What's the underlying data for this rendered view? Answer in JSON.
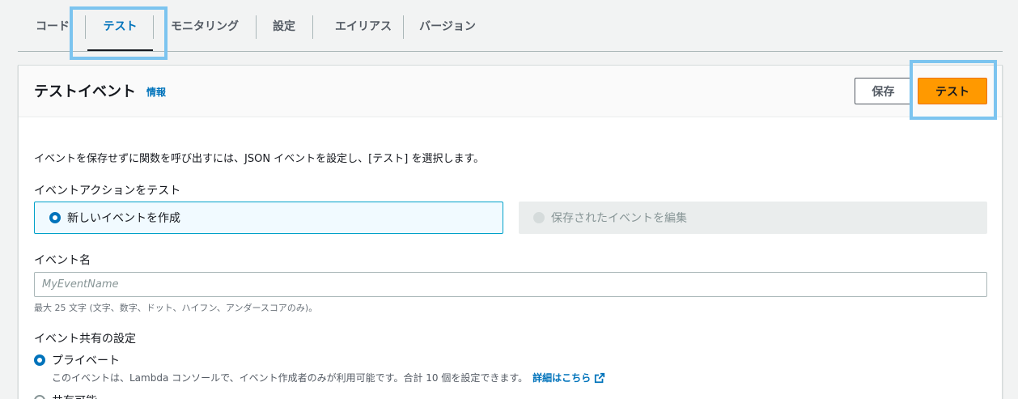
{
  "tabs": [
    {
      "label": "コード",
      "active": false
    },
    {
      "label": "テスト",
      "active": true
    },
    {
      "label": "モニタリング",
      "active": false
    },
    {
      "label": "設定",
      "active": false
    },
    {
      "label": "エイリアス",
      "active": false
    },
    {
      "label": "バージョン",
      "active": false
    }
  ],
  "panel": {
    "title": "テストイベント",
    "info_link": "情報",
    "save_label": "保存",
    "test_label": "テスト"
  },
  "description": "イベントを保存せずに関数を呼び出すには、JSON イベントを設定し、[テスト] を選択します。",
  "event_action": {
    "label": "イベントアクションをテスト",
    "options": [
      {
        "label": "新しいイベントを作成",
        "selected": true,
        "disabled": false
      },
      {
        "label": "保存されたイベントを編集",
        "selected": false,
        "disabled": true
      }
    ]
  },
  "event_name": {
    "label": "イベント名",
    "placeholder": "MyEventName",
    "value": "",
    "hint": "最大 25 文字 (文字、数字、ドット、ハイフン、アンダースコアのみ)。"
  },
  "sharing": {
    "label": "イベント共有の設定",
    "options": [
      {
        "label": "プライベート",
        "selected": true,
        "description": "このイベントは、Lambda コンソールで、イベント作成者のみが利用可能です。合計 10 個を設定できます。",
        "link": "詳細はこちら"
      },
      {
        "label": "共有可能",
        "selected": false
      }
    ]
  },
  "colors": {
    "accent": "#0073bb",
    "primary_button": "#ff9900",
    "highlight": "#7cc4ef"
  },
  "icons": {
    "external": "external-link-icon"
  }
}
